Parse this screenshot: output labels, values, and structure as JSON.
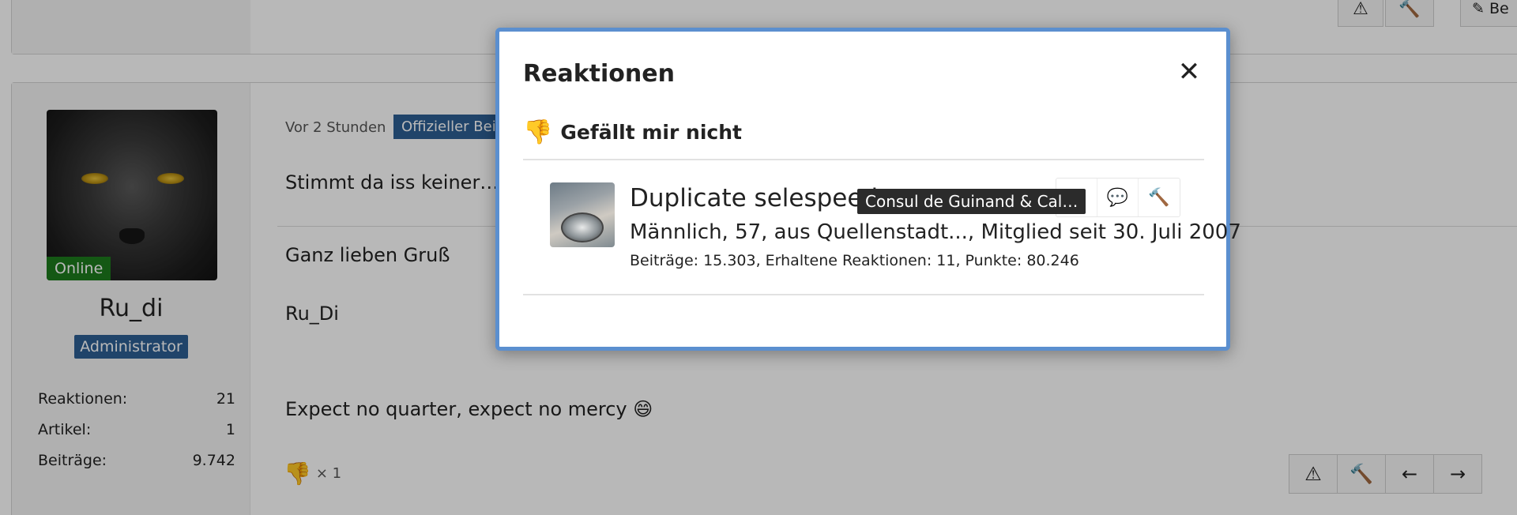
{
  "post": {
    "avatar_status": "Online",
    "username": "Ru_di",
    "role": "Administrator",
    "stats": [
      {
        "label": "Reaktionen:",
        "value": "21"
      },
      {
        "label": "Artikel:",
        "value": "1"
      },
      {
        "label": "Beiträge:",
        "value": "9.742"
      }
    ],
    "time": "Vor 2 Stunden",
    "badge": "Offizieller Beit",
    "line1": "Stimmt da iss keiner….ab",
    "greeting": "Ganz lieben Gruß",
    "signature_name": "Ru_Di",
    "motto": "Expect no quarter, expect no mercy 😄",
    "reaction_count": "× 1",
    "reaction_emoji": "👎"
  },
  "top_toolbar": {
    "edit_label": "✎ Be"
  },
  "modal": {
    "title": "Reaktionen",
    "close_icon": "✕",
    "reaction_emoji": "👎",
    "reaction_label": "Gefällt mir nicht",
    "user": {
      "name": "Duplicate selespeed",
      "tooltip": "Consul de Guinand & Cal…",
      "info": "Männlich, 57, aus Quellenstadt..., Mitglied seit 30. Juli 2007",
      "stats": "Beiträge: 15.303, Erhaltene Reaktionen: 11, Punkte: 80.246"
    }
  },
  "colors": {
    "accent": "#2d5f94",
    "online": "#1d7a1d",
    "modal_border": "#5b8fcf"
  }
}
